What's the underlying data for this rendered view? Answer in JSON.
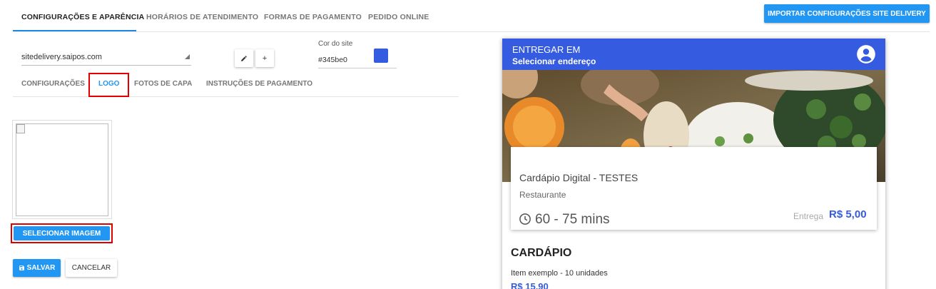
{
  "colors": {
    "accent": "#2196f3",
    "site": "#345be0",
    "highlight": "#e00000"
  },
  "topnav": {
    "tabs": [
      {
        "label": "CONFIGURAÇÕES E APARÊNCIA"
      },
      {
        "label": "HORÁRIOS DE ATENDIMENTO"
      },
      {
        "label": "FORMAS DE PAGAMENTO"
      },
      {
        "label": "PEDIDO ONLINE"
      }
    ],
    "active_tab": 0,
    "import_button": "IMPORTAR CONFIGURAÇÕES SITE DELIVERY"
  },
  "settings": {
    "site_select_value": "sitedelivery.saipos.com",
    "edit_icon": "pencil-icon",
    "add_label": "+",
    "color_label": "Cor do site",
    "color_value": "#345be0"
  },
  "subtabs": {
    "tabs": [
      {
        "label": "CONFIGURAÇÕES"
      },
      {
        "label": "LOGO"
      },
      {
        "label": "FOTOS DE CAPA"
      },
      {
        "label": "INSTRUÇÕES DE PAGAMENTO"
      }
    ],
    "active_tab": 1
  },
  "logo": {
    "select_button": "SELECIONAR IMAGEM"
  },
  "actions": {
    "save_label": "SALVAR",
    "save_icon": "floppy-disk-icon",
    "cancel_label": "CANCELAR"
  },
  "preview": {
    "header_line1": "ENTREGAR EM",
    "header_line2": "Selecionar endereço",
    "avatar_icon": "account-circle-icon",
    "restaurant_name": "Cardápio Digital - TESTES",
    "restaurant_category": "Restaurante",
    "clock_icon": "clock-icon",
    "delivery_time": "60 - 75 mins",
    "delivery_fee_label": "Entrega",
    "delivery_fee_value": "R$ 5,00",
    "menu_title": "CARDÁPIO",
    "item_name": "Item exemplo - 10 unidades",
    "item_price": "R$ 15,90"
  }
}
